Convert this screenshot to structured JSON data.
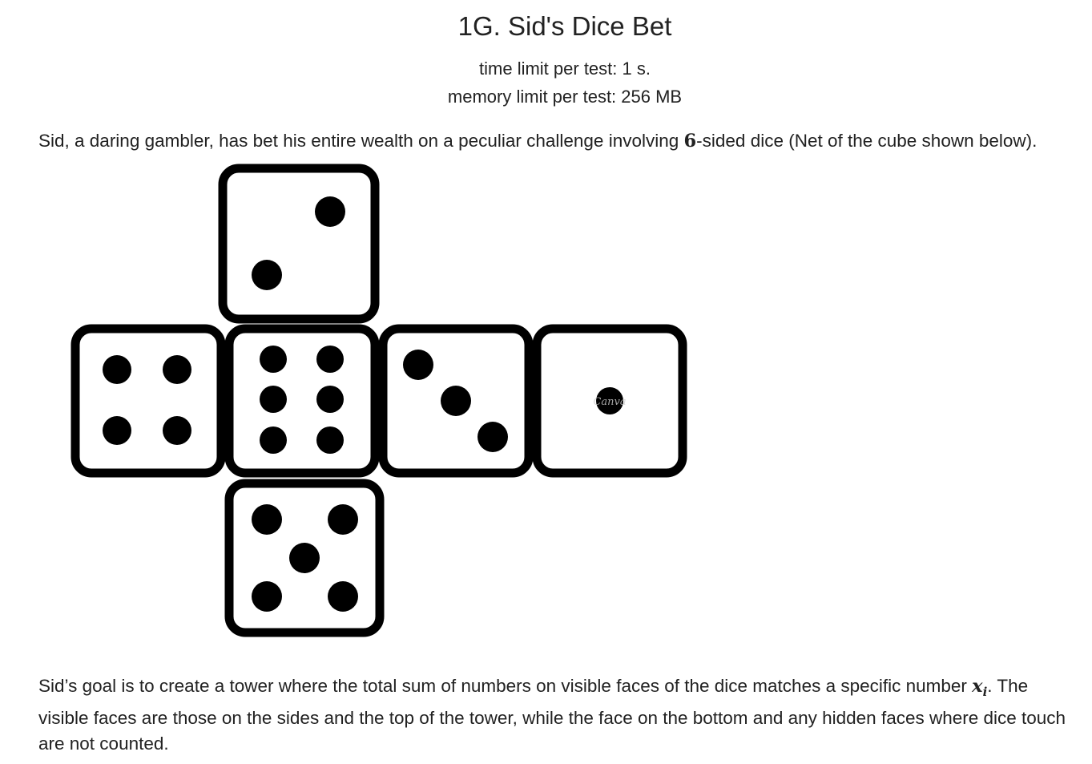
{
  "problem": {
    "title": "1G. Sid's Dice Bet",
    "time_limit": "time limit per test: 1 s.",
    "memory_limit": "memory limit per test: 256 MB"
  },
  "statement": {
    "intro_before": "Sid, a daring gambler, has bet his entire wealth on a peculiar challenge involving ",
    "intro_number": "6",
    "intro_after": "-sided dice (Net of the cube shown below).",
    "goal_before": "Sid’s goal is to create a tower where the total sum of numbers on visible faces of the dice matches a specific number ",
    "goal_var": "x",
    "goal_var_sub": "i",
    "goal_after": ". The visible faces are those on the sides and the top of the tower, while the face on the bottom and any hidden faces where dice touch are not counted."
  },
  "dice_net": {
    "faces": [
      {
        "position": "top",
        "pips": 2
      },
      {
        "position": "left",
        "pips": 4
      },
      {
        "position": "center",
        "pips": 6
      },
      {
        "position": "right",
        "pips": 3
      },
      {
        "position": "far-right",
        "pips": 1
      },
      {
        "position": "bottom",
        "pips": 5
      }
    ],
    "watermark": "Canva",
    "colors": {
      "stroke": "#000000",
      "fill": "#ffffff"
    }
  }
}
